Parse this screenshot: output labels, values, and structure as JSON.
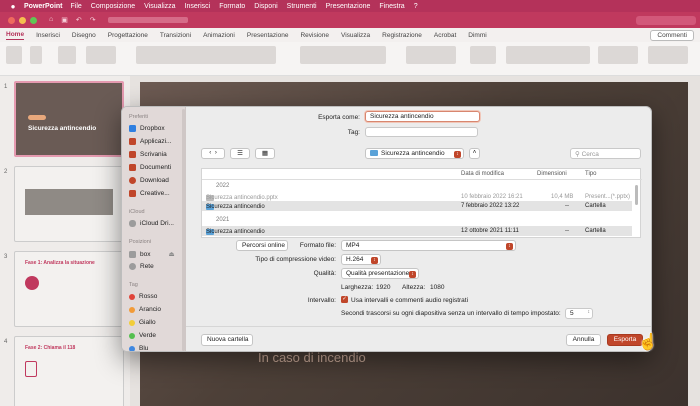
{
  "menubar": {
    "app": "PowerPoint",
    "items": [
      "File",
      "Composizione",
      "Visualizza",
      "Inserisci",
      "Formato",
      "Disponi",
      "Strumenti",
      "Presentazione",
      "Finestra",
      "?"
    ]
  },
  "ribbon": {
    "tabs": [
      "Home",
      "Inserisci",
      "Disegno",
      "Progettazione",
      "Transizioni",
      "Animazioni",
      "Presentazione",
      "Revisione",
      "Visualizza",
      "Registrazione",
      "Acrobat",
      "Dimmi"
    ],
    "active_tab": "Home",
    "comments": "Commenti"
  },
  "thumbnails": [
    {
      "num": "1",
      "title": "Sicurezza antincendio"
    },
    {
      "num": "2",
      "title": ""
    },
    {
      "num": "3",
      "title": "Fase 1: Analizza la situazione"
    },
    {
      "num": "4",
      "title": "Fase 2: Chiama il 118"
    }
  ],
  "slide": {
    "subtitle": "In caso di incendio"
  },
  "dialog": {
    "export_as_label": "Esporta come:",
    "export_as_value": "Sicurezza antincendio",
    "tag_label": "Tag:",
    "location": "Sicurezza antincendio",
    "search_placeholder": "Cerca",
    "sidebar": {
      "favorites_title": "Preferiti",
      "favorites": [
        "Dropbox",
        "Applicazi...",
        "Scrivania",
        "Documenti",
        "Download",
        "Creative..."
      ],
      "icloud_title": "iCloud",
      "icloud": [
        "iCloud Dri..."
      ],
      "locations_title": "Posizioni",
      "locations": [
        "box",
        "Rete"
      ],
      "tags_title": "Tag",
      "tags": [
        {
          "name": "Rosso",
          "color": "#e0443a"
        },
        {
          "name": "Arancio",
          "color": "#f29b38"
        },
        {
          "name": "Giallo",
          "color": "#f2cd38"
        },
        {
          "name": "Verde",
          "color": "#54bf4f"
        },
        {
          "name": "Blu",
          "color": "#3f87e0"
        }
      ]
    },
    "columns": {
      "name": "",
      "date": "Data di modifica",
      "size": "Dimensioni",
      "type": "Tipo"
    },
    "rows": [
      {
        "kind": "year",
        "name": "2022"
      },
      {
        "kind": "file",
        "name": "Sicurezza antincendio.pptx",
        "date": "10 febbraio 2022 16:21",
        "size": "10,4 MB",
        "type": "Present...(*.pptx)"
      },
      {
        "kind": "folder",
        "name": "Sicurezza antincendio",
        "date": "7 febbraio 2022 13:22",
        "size": "--",
        "type": "Cartella"
      },
      {
        "kind": "year",
        "name": "2021"
      },
      {
        "kind": "folder",
        "name": "Sicurezza antincendio",
        "date": "12 ottobre 2021 11:11",
        "size": "--",
        "type": "Cartella"
      }
    ],
    "options_button": "Percorsi online",
    "format_label": "Formato file:",
    "format_value": "MP4",
    "compression_label": "Tipo di compressione video:",
    "compression_value": "H.264",
    "quality_label": "Qualità:",
    "quality_value": "Qualità presentazione",
    "width_label": "Larghezza:",
    "width_value": "1920",
    "height_label": "Altezza:",
    "height_value": "1080",
    "interval_label": "Intervallo:",
    "interval_check": "Usa intervalli e commenti audio registrati",
    "seconds_label": "Secondi trascorsi su ogni diapositiva senza un intervallo di tempo impostato:",
    "seconds_value": "5",
    "new_folder": "Nuova cartella",
    "cancel": "Annulla",
    "export": "Esporta"
  }
}
